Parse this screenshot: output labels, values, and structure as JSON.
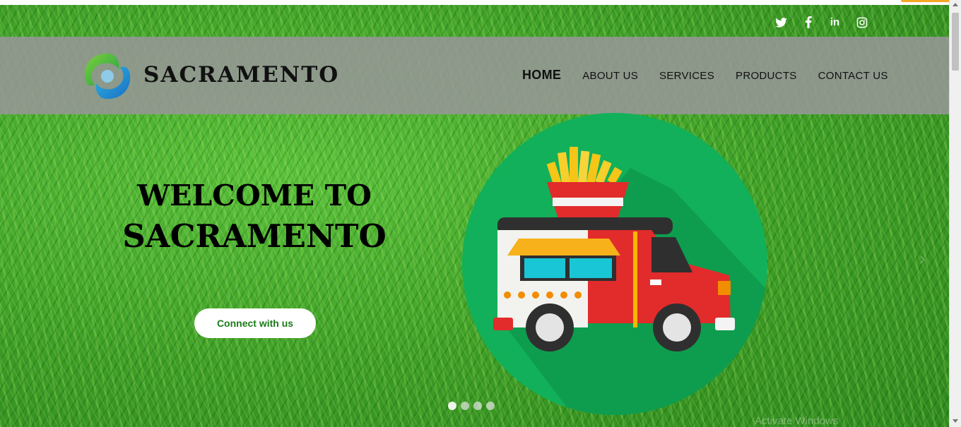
{
  "brand": {
    "name": "SACRAMENTO"
  },
  "social": {
    "icons": [
      "twitter-icon",
      "facebook-icon",
      "linkedin-icon",
      "instagram-icon"
    ],
    "linkedin_text": "in"
  },
  "nav": {
    "items": [
      {
        "label": "HOME",
        "active": true
      },
      {
        "label": "ABOUT US"
      },
      {
        "label": "SERVICES"
      },
      {
        "label": "PRODUCTS"
      },
      {
        "label": "CONTACT US"
      }
    ]
  },
  "hero": {
    "title_line1": "WELCOME TO",
    "title_line2": "SACRAMENTO",
    "cta_label": "Connect with us"
  },
  "carousel": {
    "slides": 4,
    "active_index": 0
  },
  "overlay": {
    "watermark": "Activate Windows"
  },
  "colors": {
    "accent": "#1a7a1a",
    "header_bg": "#969696",
    "circle": "#12b05a"
  }
}
